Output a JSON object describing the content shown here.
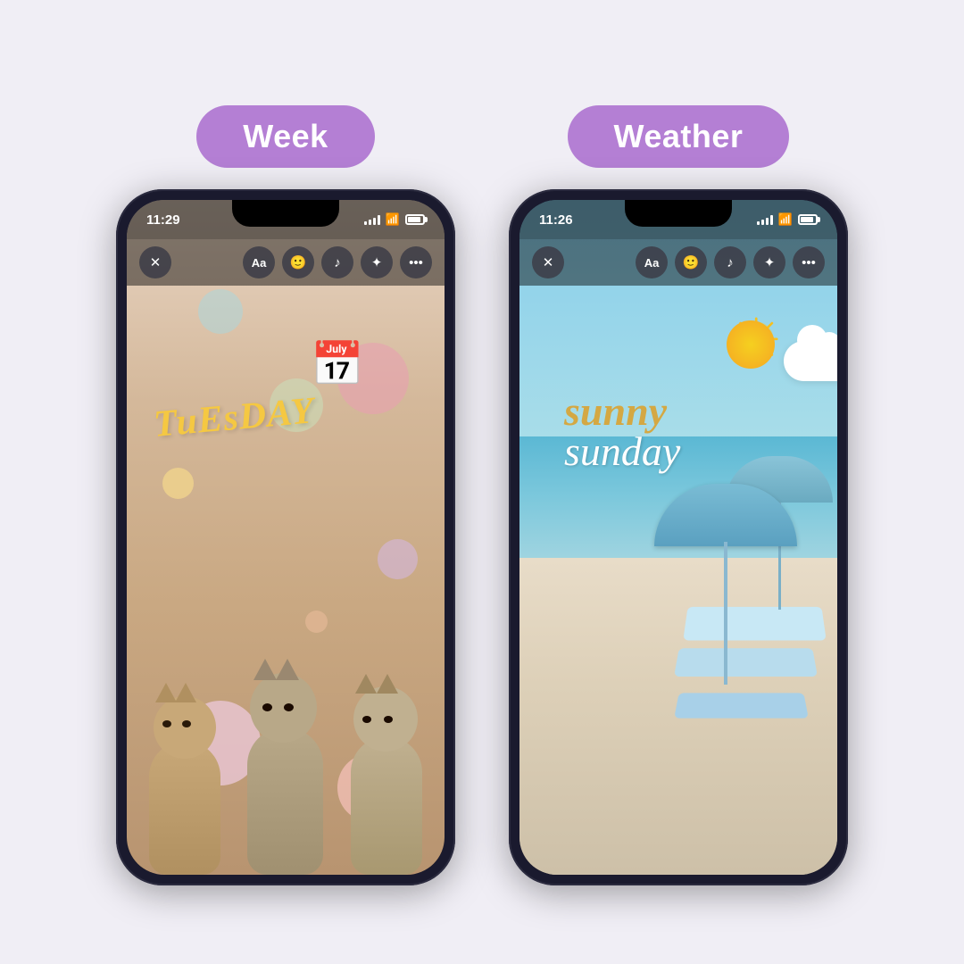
{
  "labels": {
    "left": "Week",
    "right": "Weather"
  },
  "left_phone": {
    "time": "11:29",
    "day_text": "TuEsDAY",
    "toolbar_buttons": [
      "×",
      "Aa",
      "🙂",
      "♪",
      "✦",
      "•••"
    ]
  },
  "right_phone": {
    "time": "11:26",
    "line1": "sunny",
    "line2": "sunday",
    "toolbar_buttons": [
      "×",
      "Aa",
      "🙂",
      "♪",
      "✦",
      "•••"
    ]
  },
  "colors": {
    "pill_bg": "#b47fd4",
    "pill_text": "#ffffff",
    "tuesday_color": "#f5c842",
    "sunny_line1": "#d4a843",
    "sunny_line2": "#ffffff"
  }
}
